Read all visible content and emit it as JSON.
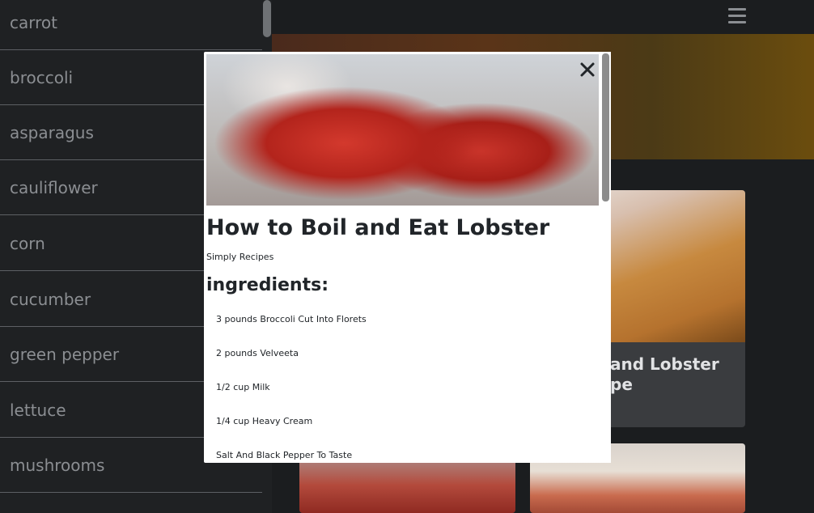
{
  "sidebar": {
    "items": [
      {
        "label": "carrot"
      },
      {
        "label": "broccoli"
      },
      {
        "label": "asparagus"
      },
      {
        "label": "cauliflower"
      },
      {
        "label": "corn"
      },
      {
        "label": "cucumber"
      },
      {
        "label": "green pepper"
      },
      {
        "label": "lettuce"
      },
      {
        "label": "mushrooms"
      }
    ]
  },
  "cards": [
    {
      "title_line1": "and Lobster",
      "title_line2": "pe"
    }
  ],
  "modal": {
    "title": "How to Boil and Eat Lobster",
    "source": "Simply Recipes",
    "ingredients_heading": "ingredients:",
    "ingredients": [
      "3 pounds Broccoli Cut Into Florets",
      "2 pounds Velveeta",
      "1/2 cup Milk",
      "1/4 cup Heavy Cream",
      "Salt And Black Pepper To Taste"
    ],
    "close_icon": "close-icon"
  }
}
